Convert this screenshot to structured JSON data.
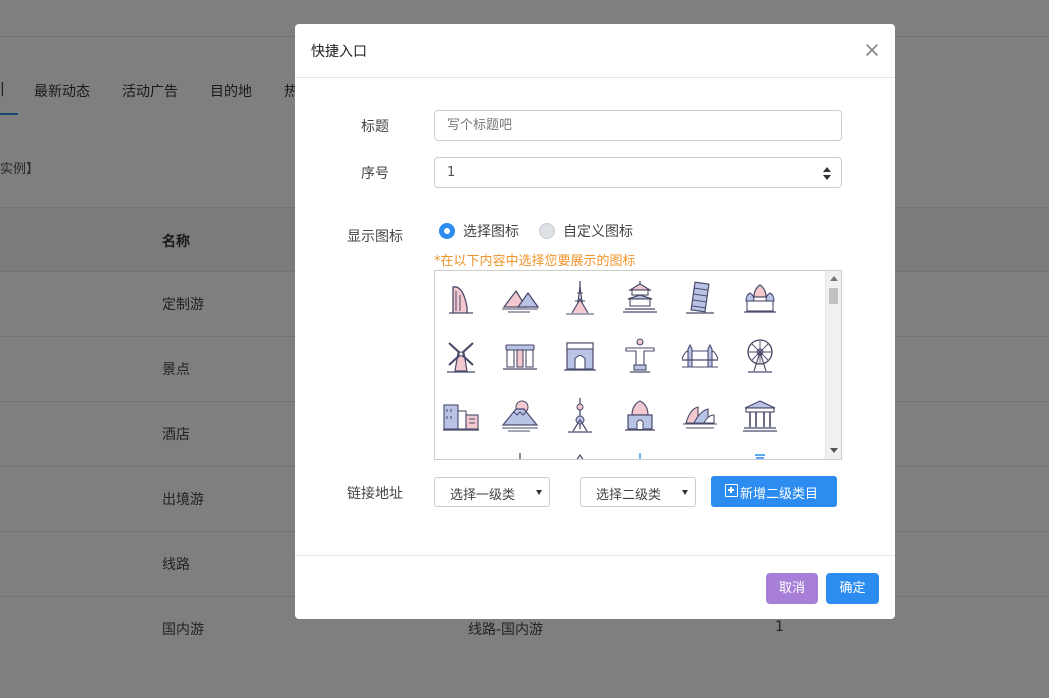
{
  "background": {
    "tabs": [
      "最新动态",
      "活动广告",
      "目的地",
      "热"
    ],
    "breadcrumb": "实例】",
    "table": {
      "name_header": "名称",
      "rows": [
        {
          "name": "定制游",
          "path": "",
          "order": ""
        },
        {
          "name": "景点",
          "path": "",
          "order": ""
        },
        {
          "name": "酒店",
          "path": "",
          "order": ""
        },
        {
          "name": "出境游",
          "path": "",
          "order": ""
        },
        {
          "name": "线路",
          "path": "",
          "order": ""
        },
        {
          "name": "国内游",
          "path": "线路-国内游",
          "order": "1"
        }
      ]
    }
  },
  "modal": {
    "title": "快捷入口",
    "close_icon": "close-icon",
    "form": {
      "title_label": "标题",
      "title_placeholder": "写个标题吧",
      "order_label": "序号",
      "order_value": "1",
      "icon_label": "显示图标",
      "radio_select_icon": "选择图标",
      "radio_custom_icon": "自定义图标",
      "radio_selected": "选择图标",
      "hint": "*在以下内容中选择您要展示的图标",
      "icons": [
        "burj-al-arab-icon",
        "pyramids-icon",
        "eiffel-tower-icon",
        "temple-of-heaven-icon",
        "leaning-tower-icon",
        "st-basils-cathedral-icon",
        "windmill-icon",
        "stonehenge-icon",
        "arc-de-triomphe-icon",
        "christ-the-redeemer-icon",
        "tower-bridge-icon",
        "ferris-wheel-icon",
        "city-buildings-icon",
        "mount-fuji-icon",
        "oriental-pearl-tower-icon",
        "taj-mahal-icon",
        "sydney-opera-house-icon",
        "parthenon-icon"
      ],
      "link_label": "链接地址",
      "select_level1": "选择一级类",
      "select_level2": "选择二级类",
      "add_button": "新增二级类目"
    },
    "footer": {
      "cancel": "取消",
      "ok": "确定"
    }
  },
  "colors": {
    "primary": "#2d8cf0",
    "cancel": "#a77fd8",
    "hint": "#f0932b"
  }
}
